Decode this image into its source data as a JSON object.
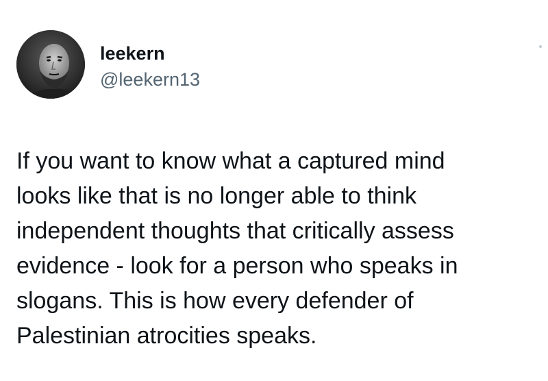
{
  "author": {
    "display_name": "leekern",
    "handle": "@leekern13",
    "avatar_icon": "profile-photo"
  },
  "tweet": {
    "lines": [
      "If you want to know what a captured mind",
      "looks like that is no longer able to think",
      "independent thoughts that critically assess",
      "evidence - look for a person who speaks in",
      "slogans. This is how every defender of",
      "Palestinian atrocities speaks."
    ]
  },
  "menu": {
    "icon": "more-options-icon"
  }
}
